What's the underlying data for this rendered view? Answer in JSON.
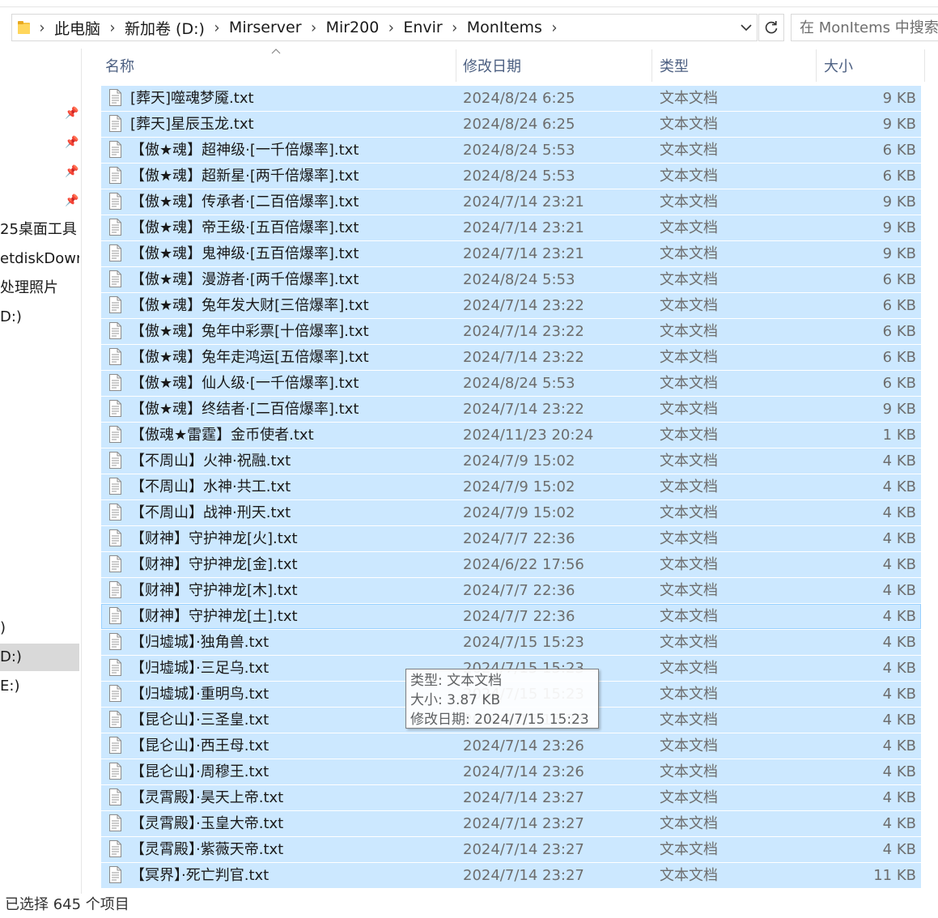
{
  "address_bar": {
    "crumbs": [
      "此电脑",
      "新加卷 (D:)",
      "Mirserver",
      "Mir200",
      "Envir",
      "MonItems"
    ]
  },
  "search": {
    "placeholder": "在 MonItems 中搜索"
  },
  "nav": {
    "items": [
      "25桌面工具",
      "etdiskDown",
      "处理照片",
      "D:)",
      ")",
      "D:)",
      "E:)"
    ]
  },
  "columns": {
    "name": "名称",
    "date": "修改日期",
    "type": "类型",
    "size": "大小"
  },
  "files": [
    {
      "name": "[葬天]噬魂梦魇.txt",
      "date": "2024/8/24 6:25",
      "type": "文本文档",
      "size": "9 KB"
    },
    {
      "name": "[葬天]星辰玉龙.txt",
      "date": "2024/8/24 6:25",
      "type": "文本文档",
      "size": "9 KB"
    },
    {
      "name": "【傲★魂】超神级·[一千倍爆率].txt",
      "date": "2024/8/24 5:53",
      "type": "文本文档",
      "size": "6 KB"
    },
    {
      "name": "【傲★魂】超新星·[两千倍爆率].txt",
      "date": "2024/8/24 5:53",
      "type": "文本文档",
      "size": "6 KB"
    },
    {
      "name": "【傲★魂】传承者·[二百倍爆率].txt",
      "date": "2024/7/14 23:21",
      "type": "文本文档",
      "size": "9 KB"
    },
    {
      "name": "【傲★魂】帝王级·[五百倍爆率].txt",
      "date": "2024/7/14 23:21",
      "type": "文本文档",
      "size": "9 KB"
    },
    {
      "name": "【傲★魂】鬼神级·[五百倍爆率].txt",
      "date": "2024/7/14 23:21",
      "type": "文本文档",
      "size": "9 KB"
    },
    {
      "name": "【傲★魂】漫游者·[两千倍爆率].txt",
      "date": "2024/8/24 5:53",
      "type": "文本文档",
      "size": "6 KB"
    },
    {
      "name": "【傲★魂】兔年发大财[三倍爆率].txt",
      "date": "2024/7/14 23:22",
      "type": "文本文档",
      "size": "6 KB"
    },
    {
      "name": "【傲★魂】兔年中彩票[十倍爆率].txt",
      "date": "2024/7/14 23:22",
      "type": "文本文档",
      "size": "6 KB"
    },
    {
      "name": "【傲★魂】兔年走鸿运[五倍爆率].txt",
      "date": "2024/7/14 23:22",
      "type": "文本文档",
      "size": "6 KB"
    },
    {
      "name": "【傲★魂】仙人级·[一千倍爆率].txt",
      "date": "2024/8/24 5:53",
      "type": "文本文档",
      "size": "6 KB"
    },
    {
      "name": "【傲★魂】终结者·[二百倍爆率].txt",
      "date": "2024/7/14 23:22",
      "type": "文本文档",
      "size": "9 KB"
    },
    {
      "name": "【傲魂★雷霆】金币使者.txt",
      "date": "2024/11/23 20:24",
      "type": "文本文档",
      "size": "1 KB"
    },
    {
      "name": "【不周山】火神·祝融.txt",
      "date": "2024/7/9 15:02",
      "type": "文本文档",
      "size": "4 KB"
    },
    {
      "name": "【不周山】水神·共工.txt",
      "date": "2024/7/9 15:02",
      "type": "文本文档",
      "size": "4 KB"
    },
    {
      "name": "【不周山】战神·刑天.txt",
      "date": "2024/7/9 15:02",
      "type": "文本文档",
      "size": "4 KB"
    },
    {
      "name": "【财神】守护神龙[火].txt",
      "date": "2024/7/7 22:36",
      "type": "文本文档",
      "size": "4 KB"
    },
    {
      "name": "【财神】守护神龙[金].txt",
      "date": "2024/6/22 17:56",
      "type": "文本文档",
      "size": "4 KB"
    },
    {
      "name": "【财神】守护神龙[木].txt",
      "date": "2024/7/7 22:36",
      "type": "文本文档",
      "size": "4 KB"
    },
    {
      "name": "【财神】守护神龙[土].txt",
      "date": "2024/7/7 22:36",
      "type": "文本文档",
      "size": "4 KB"
    },
    {
      "name": "【归墟城】·独角兽.txt",
      "date": "2024/7/15 15:23",
      "type": "文本文档",
      "size": "4 KB"
    },
    {
      "name": "【归墟城】·三足乌.txt",
      "date": "2024/7/15 15:23",
      "type": "文本文档",
      "size": "4 KB"
    },
    {
      "name": "【归墟城】·重明鸟.txt",
      "date": "2024/7/15 15:23",
      "type": "文本文档",
      "size": "4 KB"
    },
    {
      "name": "【昆仑山】·三圣皇.txt",
      "date": "2024/7/15 15:23",
      "type": "文本文档",
      "size": "4 KB"
    },
    {
      "name": "【昆仑山】·西王母.txt",
      "date": "2024/7/14 23:26",
      "type": "文本文档",
      "size": "4 KB"
    },
    {
      "name": "【昆仑山】·周穆王.txt",
      "date": "2024/7/14 23:26",
      "type": "文本文档",
      "size": "4 KB"
    },
    {
      "name": "【灵霄殿】·昊天上帝.txt",
      "date": "2024/7/14 23:27",
      "type": "文本文档",
      "size": "4 KB"
    },
    {
      "name": "【灵霄殿】·玉皇大帝.txt",
      "date": "2024/7/14 23:27",
      "type": "文本文档",
      "size": "4 KB"
    },
    {
      "name": "【灵霄殿】·紫薇天帝.txt",
      "date": "2024/7/14 23:27",
      "type": "文本文档",
      "size": "4 KB"
    },
    {
      "name": "【冥界】·死亡判官.txt",
      "date": "2024/7/14 23:27",
      "type": "文本文档",
      "size": "11 KB"
    }
  ],
  "tooltip": {
    "type": "类型: 文本文档",
    "size": "大小: 3.87 KB",
    "modified": "修改日期: 2024/7/15 15:23"
  },
  "status": {
    "selection_text": "已选择 645 个项目"
  },
  "colors": {
    "selection_bg": "#cce8ff",
    "focus_border": "#99d1ff",
    "header_text": "#4d6082"
  },
  "icons": {
    "folder": "folder-icon",
    "file": "text-file-icon",
    "pin": "pin-icon",
    "refresh": "refresh-icon"
  }
}
